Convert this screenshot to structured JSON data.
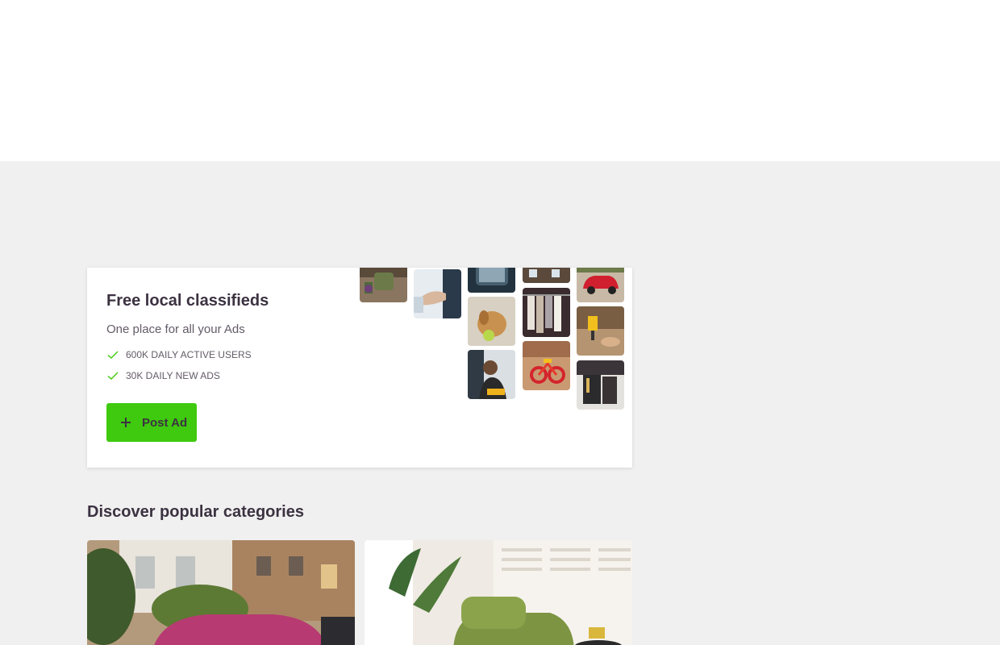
{
  "hero": {
    "title": "Free local classifieds",
    "subtitle": "One place for all your Ads",
    "stats": [
      {
        "icon": "check-icon",
        "label": "600K DAILY ACTIVE USERS"
      },
      {
        "icon": "check-icon",
        "label": "30K DAILY NEW ADS"
      }
    ],
    "post_button": {
      "icon": "plus-icon",
      "label": "Post Ad"
    },
    "tiles": [
      "armchair-photo",
      "handshake-photo",
      "phone-photo",
      "house-photo",
      "red-car-photo",
      "puppy-photo",
      "clothes-rack-photo",
      "drill-work-photo",
      "tradesperson-photo",
      "kids-bike-photo",
      "tool-belt-photo"
    ]
  },
  "categories": {
    "heading": "Discover popular categories",
    "cards": [
      {
        "name": "cars-category-card",
        "image": "street-car-photo"
      },
      {
        "name": "home-category-card",
        "image": "living-room-photo"
      }
    ]
  },
  "colors": {
    "accent": "#3fca0f",
    "text": "#3c3241",
    "muted": "#635b67",
    "background": "#f0f0f0"
  }
}
